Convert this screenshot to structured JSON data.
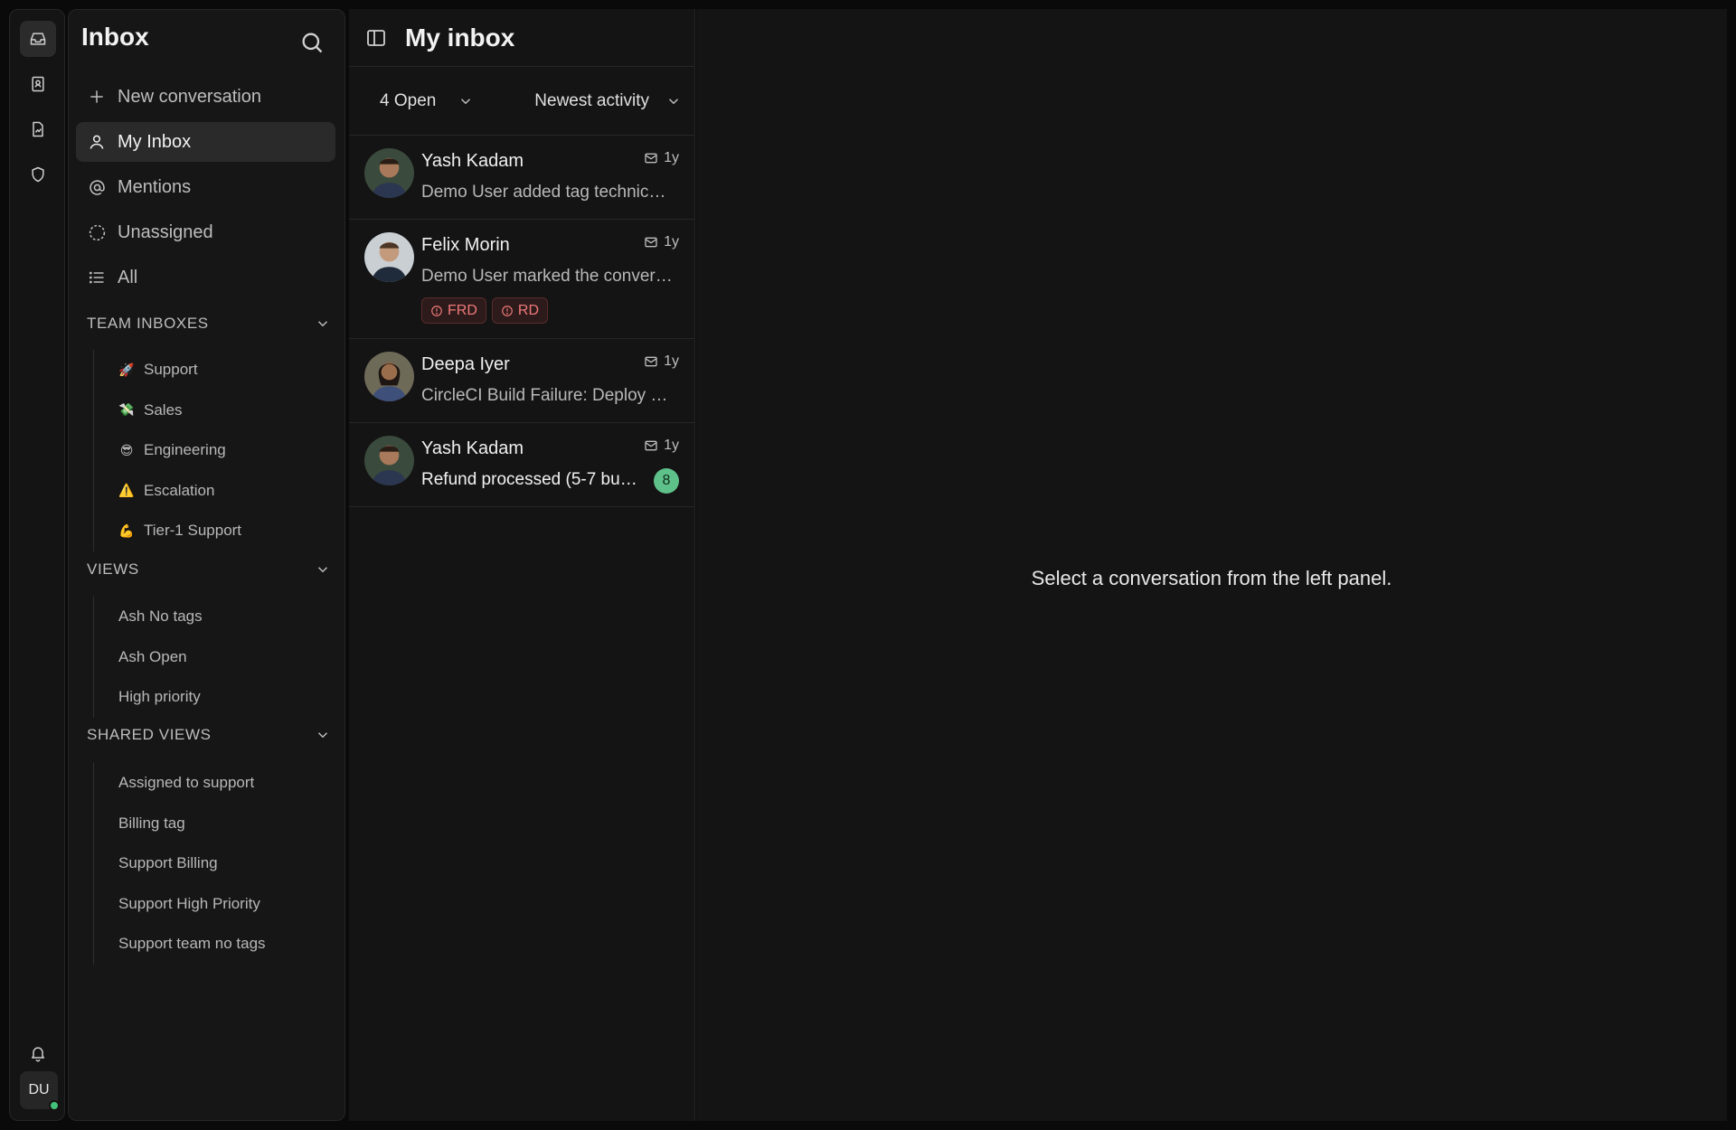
{
  "rail": {
    "items": [
      {
        "icon": "inbox-icon",
        "active": true
      },
      {
        "icon": "contacts-icon",
        "active": false
      },
      {
        "icon": "reports-icon",
        "active": false
      },
      {
        "icon": "shield-icon",
        "active": false
      }
    ],
    "user_initials": "DU"
  },
  "sidebar": {
    "title": "Inbox",
    "nav": [
      {
        "label": "New conversation",
        "icon": "plus-icon"
      },
      {
        "label": "My Inbox",
        "icon": "user-icon",
        "active": true
      },
      {
        "label": "Mentions",
        "icon": "at-icon"
      },
      {
        "label": "Unassigned",
        "icon": "dashed-circle-icon"
      },
      {
        "label": "All",
        "icon": "list-icon"
      }
    ],
    "team_inboxes": {
      "title": "TEAM INBOXES",
      "items": [
        {
          "emoji": "🚀",
          "label": "Support"
        },
        {
          "emoji": "💸",
          "label": "Sales"
        },
        {
          "emoji": "😎",
          "label": "Engineering"
        },
        {
          "emoji": "⚠️",
          "label": "Escalation"
        },
        {
          "emoji": "💪",
          "label": "Tier-1 Support"
        }
      ]
    },
    "views": {
      "title": "VIEWS",
      "items": [
        "Ash No tags",
        "Ash Open",
        "High priority"
      ]
    },
    "shared_views": {
      "title": "SHARED VIEWS",
      "items": [
        "Assigned to support",
        "Billing tag",
        "Support Billing",
        "Support High Priority",
        "Support team no tags"
      ]
    }
  },
  "conversation_list": {
    "title": "My inbox",
    "status_filter": "4 Open",
    "sort_filter": "Newest activity",
    "conversations": [
      {
        "name": "Yash Kadam",
        "time": "1y",
        "preview": "Demo User added tag technical-issue",
        "tags": [],
        "unread": null
      },
      {
        "name": "Felix Morin",
        "time": "1y",
        "preview": "Demo User marked the conversation",
        "tags": [
          "FRD",
          "RD"
        ],
        "unread": null
      },
      {
        "name": "Deepa Iyer",
        "time": "1y",
        "preview": "CircleCI Build Failure: Deploy pipeline",
        "tags": [],
        "unread": null
      },
      {
        "name": "Yash Kadam",
        "time": "1y",
        "preview": "Refund processed (5-7 business days)",
        "tags": [],
        "unread": "8"
      }
    ]
  },
  "detail": {
    "empty_message": "Select a conversation from the left panel."
  },
  "colors": {
    "background": "#0a0a0a",
    "panel": "#141414",
    "accent_green": "#5fc18a",
    "tag_red": "#f07a7a"
  }
}
